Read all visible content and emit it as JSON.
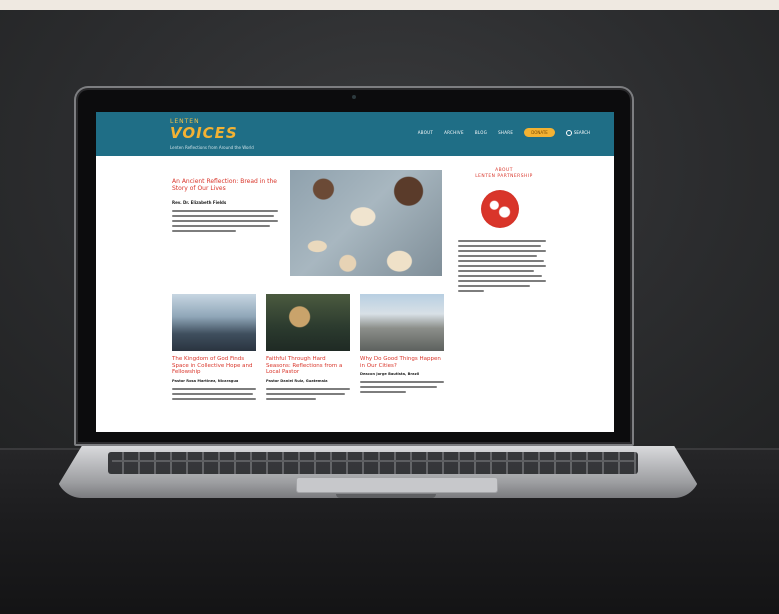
{
  "site": {
    "logo_small": "LENTEN",
    "logo_big": "VOICES",
    "tagline": "Lenten Reflections from Around the World",
    "nav": [
      "ABOUT",
      "ARCHIVE",
      "BLOG",
      "SHARE"
    ],
    "nav_button": "DONATE",
    "search_label": "SEARCH"
  },
  "feature": {
    "title": "An Ancient Reflection: Bread in the Story of Our Lives",
    "byline": "Rev. Dr. Elizabeth Fields"
  },
  "cards": [
    {
      "title": "The Kingdom of God Finds Space in Collective Hope and Fellowship",
      "meta": "Pastor Rosa Martinez, Nicaragua"
    },
    {
      "title": "Faithful Through Hard Seasons: Reflections from a Local Pastor",
      "meta": "Pastor Daniel Ruiz, Guatemala"
    },
    {
      "title": "Why Do Good Things Happen in Our Cities?",
      "meta": "Deacon Jorge Bautista, Brazil"
    }
  ],
  "sidebar": {
    "title_line1": "ABOUT",
    "title_line2": "LENTEN PARTNERSHIP"
  },
  "colors": {
    "header": "#1f6e86",
    "accent": "#f3b233",
    "title_red": "#d9352a"
  }
}
